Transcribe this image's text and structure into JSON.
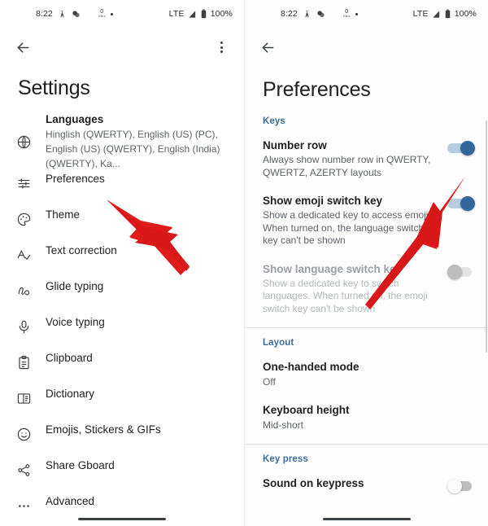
{
  "status_bar": {
    "time": "8:22",
    "network_speed": "0",
    "network_unit": "KB/s",
    "network_type": "LTE",
    "battery_percent": "100%",
    "icons": [
      "person-icon",
      "apps-overlap-icon",
      "crescent-moon-icon",
      "network-speed-icon",
      "dot-icon",
      "signal-bars-icon",
      "battery-icon"
    ]
  },
  "left_screen": {
    "appbar": {
      "back": "back-arrow",
      "overflow": "more-options"
    },
    "title": "Settings",
    "items": [
      {
        "icon": "globe-icon",
        "label": "Languages",
        "sub": "Hinglish (QWERTY), English (US) (PC), English (US) (QWERTY), English (India) (QWERTY), Ka..."
      },
      {
        "icon": "sliders-icon",
        "label": "Preferences",
        "sub": ""
      },
      {
        "icon": "palette-icon",
        "label": "Theme",
        "sub": ""
      },
      {
        "icon": "spellcheck-icon",
        "label": "Text correction",
        "sub": ""
      },
      {
        "icon": "gesture-icon",
        "label": "Glide typing",
        "sub": ""
      },
      {
        "icon": "microphone-icon",
        "label": "Voice typing",
        "sub": ""
      },
      {
        "icon": "clipboard-icon",
        "label": "Clipboard",
        "sub": ""
      },
      {
        "icon": "book-icon",
        "label": "Dictionary",
        "sub": ""
      },
      {
        "icon": "emoji-smiley-icon",
        "label": "Emojis, Stickers & GIFs",
        "sub": ""
      },
      {
        "icon": "share-icon",
        "label": "Share Gboard",
        "sub": ""
      },
      {
        "icon": "more-horizontal-icon",
        "label": "Advanced",
        "sub": ""
      }
    ]
  },
  "right_screen": {
    "appbar": {
      "back": "back-arrow"
    },
    "title": "Preferences",
    "sections": [
      {
        "header": "Keys",
        "rows": [
          {
            "title": "Number row",
            "desc": "Always show number row in QWERTY, QWERTZ, AZERTY layouts",
            "toggle": "on",
            "disabled": false
          },
          {
            "title": "Show emoji switch key",
            "desc": "Show a dedicated key to access emoji. When turned on, the language switch key can't be shown",
            "toggle": "on",
            "disabled": false
          },
          {
            "title": "Show language switch key",
            "desc": "Show a dedicated key to switch languages. When turned on, the emoji switch key can't be shown",
            "toggle": "off-dim",
            "disabled": true
          }
        ]
      },
      {
        "header": "Layout",
        "rows": [
          {
            "title": "One-handed mode",
            "value": "Off",
            "toggle": null,
            "disabled": false
          },
          {
            "title": "Keyboard height",
            "value": "Mid-short",
            "toggle": null,
            "disabled": false
          }
        ]
      },
      {
        "header": "Key press",
        "rows": [
          {
            "title": "Sound on keypress",
            "desc": "",
            "toggle": "off",
            "disabled": false
          }
        ]
      }
    ]
  },
  "annotations": {
    "arrow_color": "#e01b1b",
    "arrows": [
      {
        "name": "arrow-pointing-to-preferences",
        "target": "Preferences"
      },
      {
        "name": "arrow-pointing-to-number-row-toggle",
        "target": "Number row toggle"
      }
    ]
  }
}
